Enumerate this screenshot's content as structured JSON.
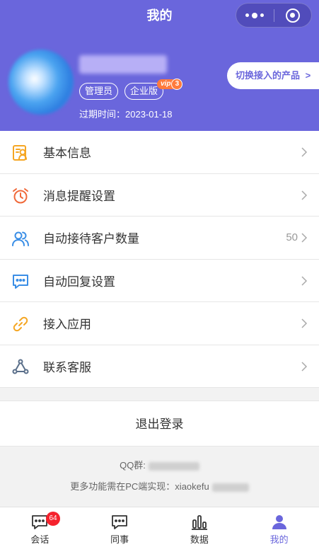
{
  "nav": {
    "title": "我的"
  },
  "profile": {
    "role_badge": "管理员",
    "edition_badge": "企业版",
    "vip_text": "vip",
    "vip_level": "3",
    "expire_label": "过期时间：",
    "expire_date": "2023-01-18",
    "switch_product_label": "切换接入的产品",
    "switch_product_arrow": ">"
  },
  "menu": {
    "items": [
      {
        "label": "基本信息",
        "icon": "profile-card-icon",
        "color": "#f5a623"
      },
      {
        "label": "消息提醒设置",
        "icon": "alarm-clock-icon",
        "color": "#f0693a"
      },
      {
        "label": "自动接待客户数量",
        "icon": "users-icon",
        "color": "#3a8ee6",
        "value": "50"
      },
      {
        "label": "自动回复设置",
        "icon": "chat-bubble-icon",
        "color": "#3a8ee6"
      },
      {
        "label": "接入应用",
        "icon": "link-icon",
        "color": "#f5a623"
      },
      {
        "label": "联系客服",
        "icon": "service-icon",
        "color": "#5a6f8a"
      }
    ]
  },
  "logout": {
    "label": "退出登录"
  },
  "footer": {
    "qq_label": "QQ群:",
    "pc_label": "更多功能需在PC端实现：xiaokefu"
  },
  "tabbar": {
    "tabs": [
      {
        "label": "会话",
        "icon": "chat-icon",
        "badge": "64"
      },
      {
        "label": "同事",
        "icon": "message-icon"
      },
      {
        "label": "数据",
        "icon": "bar-chart-icon"
      },
      {
        "label": "我的",
        "icon": "person-icon",
        "active": true
      }
    ]
  },
  "colors": {
    "primary": "#6a66dc",
    "badge_red": "#f5222d",
    "vip_orange": "#ff7a3c"
  }
}
